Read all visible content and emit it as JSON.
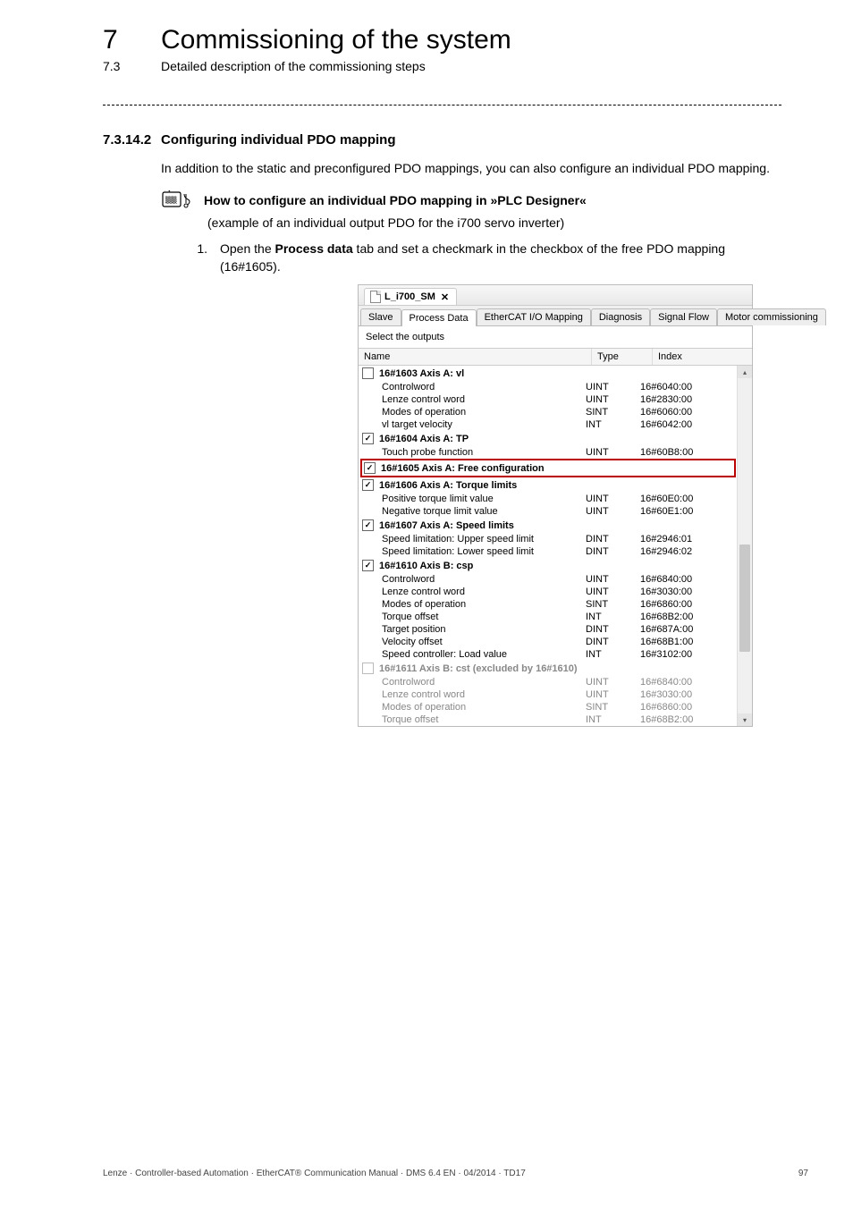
{
  "header": {
    "chapter_num": "7",
    "chapter_title": "Commissioning of the system",
    "sub_num": "7.3",
    "sub_title": "Detailed description of the commissioning steps"
  },
  "section": {
    "num": "7.3.14.2",
    "title": "Configuring individual PDO mapping",
    "intro": "In addition to the static and preconfigured PDO mappings, you can also configure an individual PDO mapping.",
    "howto_title": "How to configure an individual PDO mapping in »PLC Designer«",
    "example_note": "(example of an individual output PDO for the i700 servo inverter)",
    "step_num": "1.",
    "step_pre": "Open the ",
    "step_bold": "Process data",
    "step_post": " tab and set a checkmark in the checkbox of the free PDO mapping (16#1605)."
  },
  "shot": {
    "window_tab": "L_i700_SM",
    "close_glyph": "✕",
    "tabs": [
      "Slave",
      "Process Data",
      "EtherCAT I/O Mapping",
      "Diagnosis",
      "Signal Flow",
      "Motor commissioning"
    ],
    "active_tab": 1,
    "select_label": "Select the outputs",
    "columns": {
      "name": "Name",
      "type": "Type",
      "index": "Index"
    },
    "groups": [
      {
        "label": "16#1603 Axis A: vl",
        "checked": false,
        "disabled": false,
        "highlight": false,
        "items": [
          {
            "name": "Controlword",
            "type": "UINT",
            "index": "16#6040:00"
          },
          {
            "name": "Lenze control word",
            "type": "UINT",
            "index": "16#2830:00"
          },
          {
            "name": "Modes of operation",
            "type": "SINT",
            "index": "16#6060:00"
          },
          {
            "name": "vl target velocity",
            "type": "INT",
            "index": "16#6042:00"
          }
        ]
      },
      {
        "label": "16#1604 Axis A: TP",
        "checked": true,
        "disabled": false,
        "highlight": false,
        "items": [
          {
            "name": "Touch probe function",
            "type": "UINT",
            "index": "16#60B8:00"
          }
        ]
      },
      {
        "label": "16#1605 Axis A: Free configuration",
        "checked": true,
        "disabled": false,
        "highlight": true,
        "items": []
      },
      {
        "label": "16#1606 Axis A: Torque limits",
        "checked": true,
        "disabled": false,
        "highlight": false,
        "items": [
          {
            "name": "Positive torque limit value",
            "type": "UINT",
            "index": "16#60E0:00"
          },
          {
            "name": "Negative torque limit value",
            "type": "UINT",
            "index": "16#60E1:00"
          }
        ]
      },
      {
        "label": "16#1607 Axis A: Speed limits",
        "checked": true,
        "disabled": false,
        "highlight": false,
        "items": [
          {
            "name": "Speed limitation: Upper speed limit",
            "type": "DINT",
            "index": "16#2946:01"
          },
          {
            "name": "Speed limitation: Lower speed limit",
            "type": "DINT",
            "index": "16#2946:02"
          }
        ]
      },
      {
        "label": "16#1610 Axis B: csp",
        "checked": true,
        "disabled": false,
        "highlight": false,
        "items": [
          {
            "name": "Controlword",
            "type": "UINT",
            "index": "16#6840:00"
          },
          {
            "name": "Lenze control word",
            "type": "UINT",
            "index": "16#3030:00"
          },
          {
            "name": "Modes of operation",
            "type": "SINT",
            "index": "16#6860:00"
          },
          {
            "name": "Torque offset",
            "type": "INT",
            "index": "16#68B2:00"
          },
          {
            "name": "Target position",
            "type": "DINT",
            "index": "16#687A:00"
          },
          {
            "name": "Velocity offset",
            "type": "DINT",
            "index": "16#68B1:00"
          },
          {
            "name": "Speed controller: Load value",
            "type": "INT",
            "index": "16#3102:00"
          }
        ]
      },
      {
        "label": "16#1611 Axis B: cst (excluded by 16#1610)",
        "checked": false,
        "disabled": true,
        "highlight": false,
        "items": [
          {
            "name": "Controlword",
            "type": "UINT",
            "index": "16#6840:00"
          },
          {
            "name": "Lenze control word",
            "type": "UINT",
            "index": "16#3030:00"
          },
          {
            "name": "Modes of operation",
            "type": "SINT",
            "index": "16#6860:00"
          },
          {
            "name": "Torque offset",
            "type": "INT",
            "index": "16#68B2:00"
          }
        ]
      }
    ]
  },
  "footer": {
    "left": "Lenze · Controller-based Automation · EtherCAT® Communication Manual · DMS 6.4 EN · 04/2014 · TD17",
    "right": "97"
  }
}
